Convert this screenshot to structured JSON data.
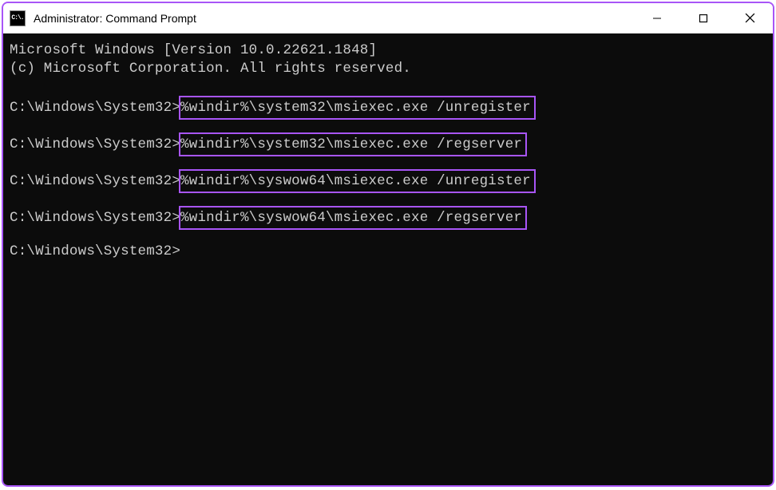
{
  "titlebar": {
    "icon_text": "C:\\.",
    "title": "Administrator: Command Prompt"
  },
  "terminal": {
    "header_line1": "Microsoft Windows [Version 10.0.22621.1848]",
    "header_line2": "(c) Microsoft Corporation. All rights reserved.",
    "prompt": "C:\\Windows\\System32>",
    "commands": [
      "%windir%\\system32\\msiexec.exe /unregister",
      "%windir%\\system32\\msiexec.exe /regserver",
      "%windir%\\syswow64\\msiexec.exe /unregister",
      "%windir%\\syswow64\\msiexec.exe /regserver"
    ]
  }
}
